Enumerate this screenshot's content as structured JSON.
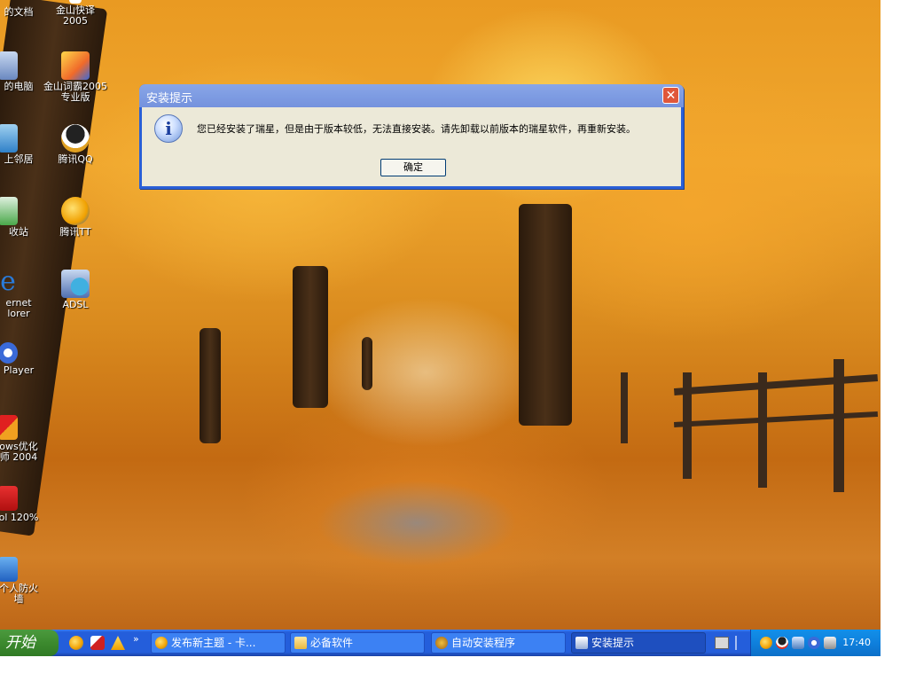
{
  "desktop": {
    "icons": [
      {
        "label": "的文档",
        "icon": "documents-icon"
      },
      {
        "label": "金山快译",
        "label2": "2005",
        "icon": "kingsoft-fastait-icon"
      },
      {
        "label": "的电脑",
        "icon": "my-computer-icon"
      },
      {
        "label": "金山词霸2005",
        "label2": "专业版",
        "icon": "kingsoft-powerword-icon"
      },
      {
        "label": "上邻居",
        "icon": "network-places-icon"
      },
      {
        "label": "腾讯QQ",
        "icon": "qq-penguin-icon"
      },
      {
        "label": "收站",
        "icon": "recycle-bin-icon"
      },
      {
        "label": "腾讯TT",
        "icon": "tencent-tt-icon"
      },
      {
        "label": "ernet",
        "label2": "lorer",
        "icon": "internet-explorer-icon"
      },
      {
        "label": "ADSL",
        "icon": "adsl-connection-icon"
      },
      {
        "label": "Player",
        "icon": "media-player-icon"
      },
      {
        "label": "ows优化",
        "label2": "师 2004",
        "icon": "windows-optimizer-icon"
      },
      {
        "label": "ol 120%",
        "icon": "acdsee-icon"
      },
      {
        "label": "个人防火",
        "label2": "墙",
        "icon": "firewall-icon"
      }
    ]
  },
  "dialog": {
    "title": "安装提示",
    "close_label": "✕",
    "message": "您已经安装了瑞星，但是由于版本较低，无法直接安装。请先卸载以前版本的瑞星软件，再重新安装。",
    "ok_label": "确定",
    "icon": "info-icon"
  },
  "taskbar": {
    "start_label": "开始",
    "quicklaunch_more": "»",
    "tasks": [
      {
        "label": "发布新主题 - 卡...",
        "icon": "browser-icon",
        "active": false
      },
      {
        "label": "必备软件",
        "icon": "folder-icon",
        "active": false
      },
      {
        "label": "自动安装程序",
        "icon": "installer-icon",
        "active": false
      },
      {
        "label": "安装提示",
        "icon": "setup-window-icon",
        "active": true
      }
    ],
    "clock": "17:40"
  },
  "colors": {
    "taskbar_blue": "#245edb",
    "start_green": "#3c8a2e",
    "dialog_face": "#ece9d8",
    "title_blue": "#7f9de3"
  }
}
